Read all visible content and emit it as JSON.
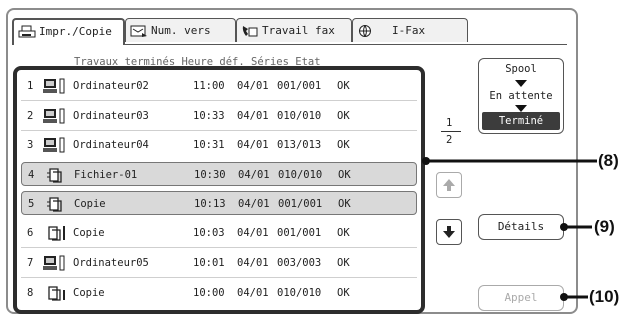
{
  "tabs": [
    {
      "label": "Impr./Copie",
      "icon": "printer-icon",
      "active": true
    },
    {
      "label": "Num. vers",
      "icon": "scan-icon",
      "active": false
    },
    {
      "label": "Travail fax",
      "icon": "fax-icon",
      "active": false
    },
    {
      "label": "I-Fax",
      "icon": "internet-fax-icon",
      "active": false
    }
  ],
  "column_header": "Travaux terminés Heure déf. Séries Etat",
  "jobs": [
    {
      "num": "1",
      "name": "Ordinateur02",
      "time": "11:00",
      "date": "04/01",
      "pages": "001/001",
      "status": "OK",
      "icon": "computer-icon",
      "selected": false
    },
    {
      "num": "2",
      "name": "Ordinateur03",
      "time": "10:33",
      "date": "04/01",
      "pages": "010/010",
      "status": "OK",
      "icon": "computer-icon",
      "selected": false
    },
    {
      "num": "3",
      "name": "Ordinateur04",
      "time": "10:31",
      "date": "04/01",
      "pages": "013/013",
      "status": "OK",
      "icon": "computer-icon",
      "selected": false
    },
    {
      "num": "4",
      "name": "Fichier-01",
      "time": "10:30",
      "date": "04/01",
      "pages": "010/010",
      "status": "OK",
      "icon": "copy-icon",
      "selected": true
    },
    {
      "num": "5",
      "name": "Copie",
      "time": "10:13",
      "date": "04/01",
      "pages": "001/001",
      "status": "OK",
      "icon": "copy-icon",
      "selected": true
    },
    {
      "num": "6",
      "name": "Copie",
      "time": "10:03",
      "date": "04/01",
      "pages": "001/001",
      "status": "OK",
      "icon": "copy-icon",
      "selected": false
    },
    {
      "num": "7",
      "name": "Ordinateur05",
      "time": "10:01",
      "date": "04/01",
      "pages": "003/003",
      "status": "OK",
      "icon": "computer-icon",
      "selected": false
    },
    {
      "num": "8",
      "name": "Copie",
      "time": "10:00",
      "date": "04/01",
      "pages": "010/010",
      "status": "OK",
      "icon": "copy-icon",
      "selected": false
    }
  ],
  "pager": {
    "current": "1",
    "total": "2"
  },
  "spool": {
    "line1": "Spool",
    "line2": "En attente",
    "selected": "Terminé"
  },
  "buttons": {
    "details": "Détails",
    "recall": "Appel"
  },
  "callouts": {
    "c8": "(8)",
    "c9": "(9)",
    "c10": "(10)"
  }
}
